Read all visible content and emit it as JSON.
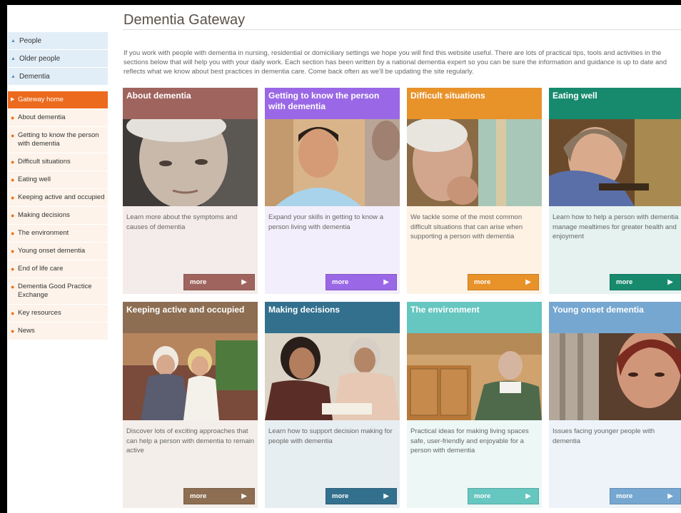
{
  "page": {
    "title": "Dementia Gateway",
    "intro": "If you work with people with dementia in nursing, residential or domiciliary settings we hope you will find this website useful. There are lots of practical tips, tools and activities in the sections below that will help you with your daily work. Each section has been written by a national dementia expert so you can be sure the information and guidance is up to date and reflects what we know about best practices in dementia care. Come back often as we'll be updating the site regularly."
  },
  "sidebar": {
    "top_items": [
      "People",
      "Older people",
      "Dementia"
    ],
    "sub_items": [
      "Gateway home",
      "About dementia",
      "Getting to know the person with dementia",
      "Difficult situations",
      "Eating well",
      "Keeping active and occupied",
      "Making decisions",
      "The environment",
      "Young onset dementia",
      "End of life care",
      "Dementia Good Practice Exchange",
      "Key resources",
      "News"
    ],
    "active_item": "Gateway home"
  },
  "cards": [
    {
      "title": "About dementia",
      "description": "Learn more about the symptoms and causes of dementia",
      "more": "more",
      "head_color": "#a0645f",
      "body_color": "#f4ecea",
      "btn_color": "#a0645f",
      "image": "elderly-woman-portrait"
    },
    {
      "title": "Getting to know the person with dementia",
      "description": "Expand your skills in getting to know a person living with dementia",
      "more": "more",
      "head_color": "#9a68e6",
      "body_color": "#f3eefb",
      "btn_color": "#9a68e6",
      "image": "carer-smiling"
    },
    {
      "title": "Difficult situations",
      "description": "We tackle some of the most common difficult situations that can arise when supporting a person with dementia",
      "more": "more",
      "head_color": "#e8922a",
      "body_color": "#fdf2e4",
      "btn_color": "#e8922a",
      "image": "elderly-woman-thinking"
    },
    {
      "title": "Eating well",
      "description": "Learn how to help a person with dementia manage mealtimes for greater health and enjoyment",
      "more": "more",
      "head_color": "#178a6e",
      "body_color": "#e5f2ef",
      "btn_color": "#178a6e",
      "image": "elderly-woman-eating"
    },
    {
      "title": "Keeping active and occupied",
      "description": "Discover lots of exciting approaches that can help a person with dementia to remain active",
      "more": "more",
      "head_color": "#8d6e52",
      "body_color": "#f3eeea",
      "btn_color": "#8d6e52",
      "image": "two-women-walking"
    },
    {
      "title": "Making decisions",
      "description": "Learn how to support decision making for people with dementia",
      "more": "more",
      "head_color": "#33708e",
      "body_color": "#e7eef2",
      "btn_color": "#33708e",
      "image": "women-reading"
    },
    {
      "title": "The environment",
      "description": "Practical ideas for making living spaces safe, user-friendly and enjoyable for a person with dementia",
      "more": "more",
      "head_color": "#66c6c0",
      "body_color": "#ecf7f6",
      "btn_color": "#66c6c0",
      "image": "man-in-kitchen"
    },
    {
      "title": "Young onset dementia",
      "description": "Issues facing younger people with dementia",
      "more": "more",
      "head_color": "#76a7d0",
      "body_color": "#edf3f9",
      "btn_color": "#76a7d0",
      "image": "woman-by-window"
    }
  ]
}
